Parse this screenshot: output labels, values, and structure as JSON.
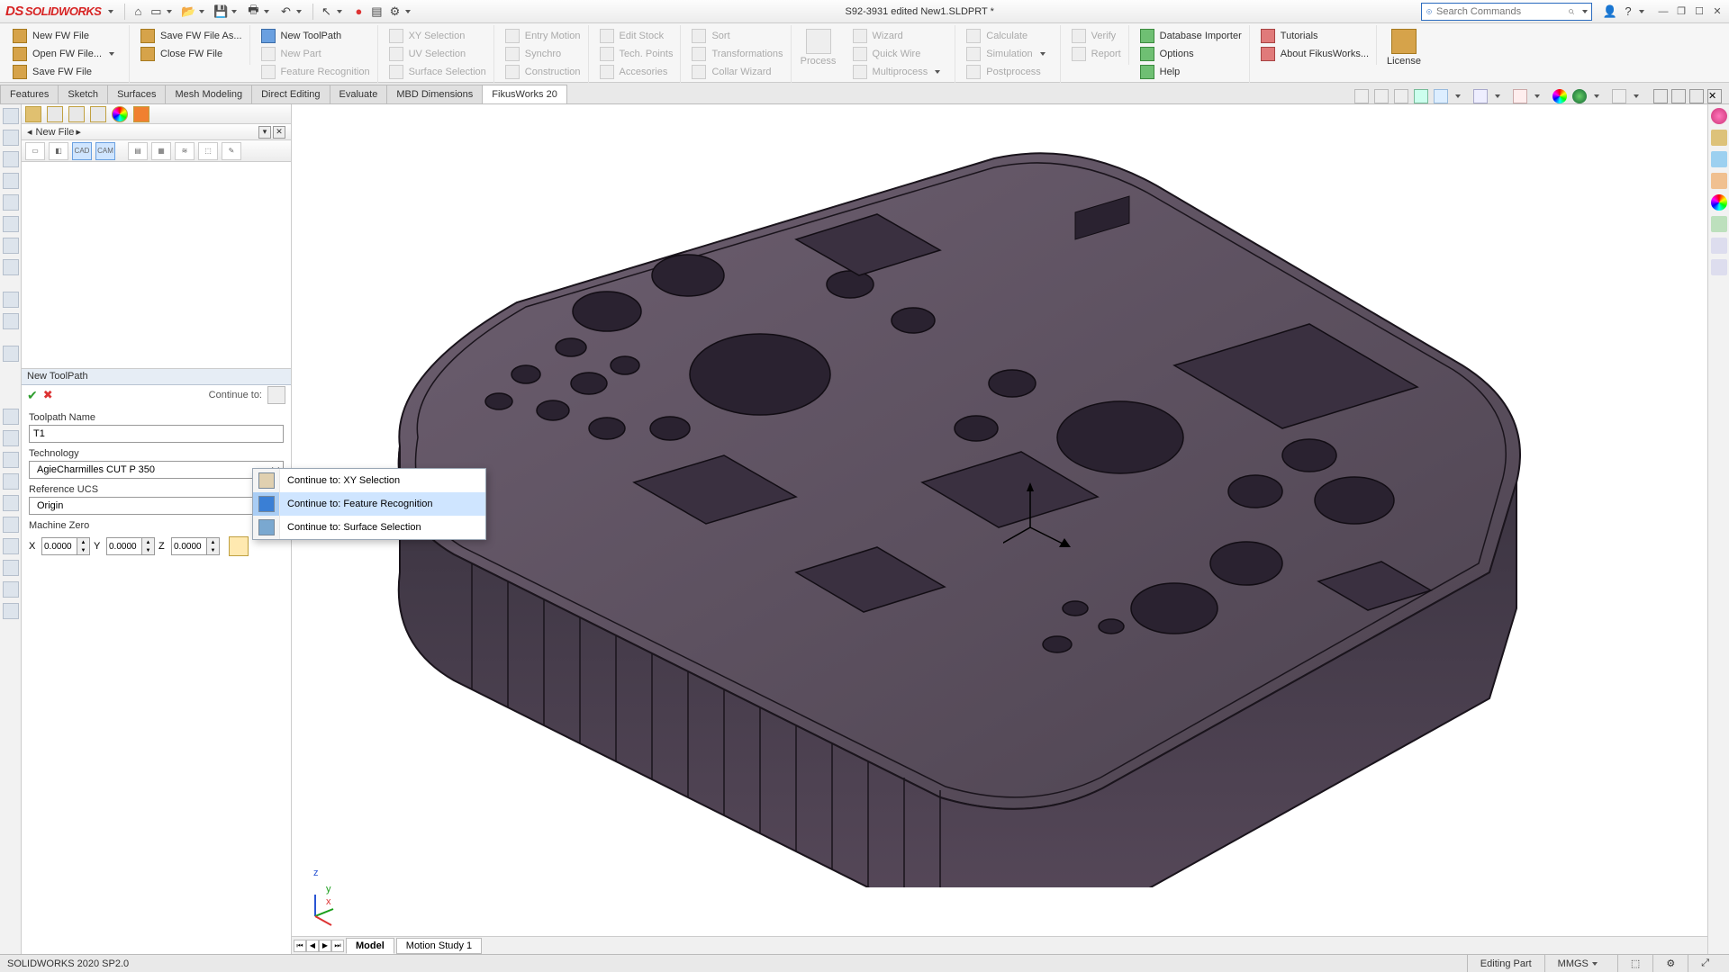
{
  "title": "S92-3931 edited New1.SLDPRT *",
  "search_placeholder": "Search Commands",
  "ribbon": {
    "g1": {
      "a": "New FW File",
      "b": "Open FW File...",
      "c": "Save FW File"
    },
    "g2": {
      "a": "Save FW File As...",
      "b": "Close FW File"
    },
    "g3": {
      "a": "New ToolPath",
      "b": "New Part",
      "c": "Feature Recognition"
    },
    "g4": {
      "a": "XY Selection",
      "b": "UV Selection",
      "c": "Surface Selection"
    },
    "g5": {
      "a": "Entry Motion",
      "b": "Synchro",
      "c": "Construction"
    },
    "g6": {
      "a": "Edit Stock",
      "b": "Tech. Points",
      "c": "Accesories"
    },
    "g7": {
      "a": "Sort",
      "b": "Transformations",
      "c": "Collar Wizard"
    },
    "g8": "Process",
    "g9": {
      "a": "Wizard",
      "b": "Quick Wire",
      "c": "Multiprocess"
    },
    "g10": {
      "a": "Calculate",
      "b": "Simulation",
      "c": "Postprocess"
    },
    "g11": {
      "a": "Verify",
      "b": "Report"
    },
    "g12": {
      "a": "Database Importer",
      "b": "Options",
      "c": "Help"
    },
    "g13": {
      "a": "Tutorials",
      "b": "About FikusWorks..."
    },
    "g14": "License"
  },
  "tabs": [
    "Features",
    "Sketch",
    "Surfaces",
    "Mesh Modeling",
    "Direct Editing",
    "Evaluate",
    "MBD Dimensions",
    "FikusWorks 20"
  ],
  "active_tab": 7,
  "panel": {
    "file_crumb": "New File",
    "tp_title": "New ToolPath",
    "continue_to": "Continue to:",
    "toolpath_name_label": "Toolpath Name",
    "toolpath_name_value": "T1",
    "tech_label": "Technology",
    "tech_value": "AgieCharmilles CUT P 350",
    "ucs_label": "Reference UCS",
    "ucs_value": "Origin",
    "mz_label": "Machine Zero",
    "mz": {
      "x": "0.0000",
      "y": "0.0000",
      "z": "0.0000"
    }
  },
  "context_menu": [
    "Continue to: XY Selection",
    "Continue to: Feature Recognition",
    "Continue to: Surface Selection"
  ],
  "context_hl": 1,
  "bottom_tabs": [
    "Model",
    "Motion Study 1"
  ],
  "status": {
    "left": "SOLIDWORKS 2020 SP2.0",
    "mode": "Editing Part",
    "units": "MMGS"
  }
}
